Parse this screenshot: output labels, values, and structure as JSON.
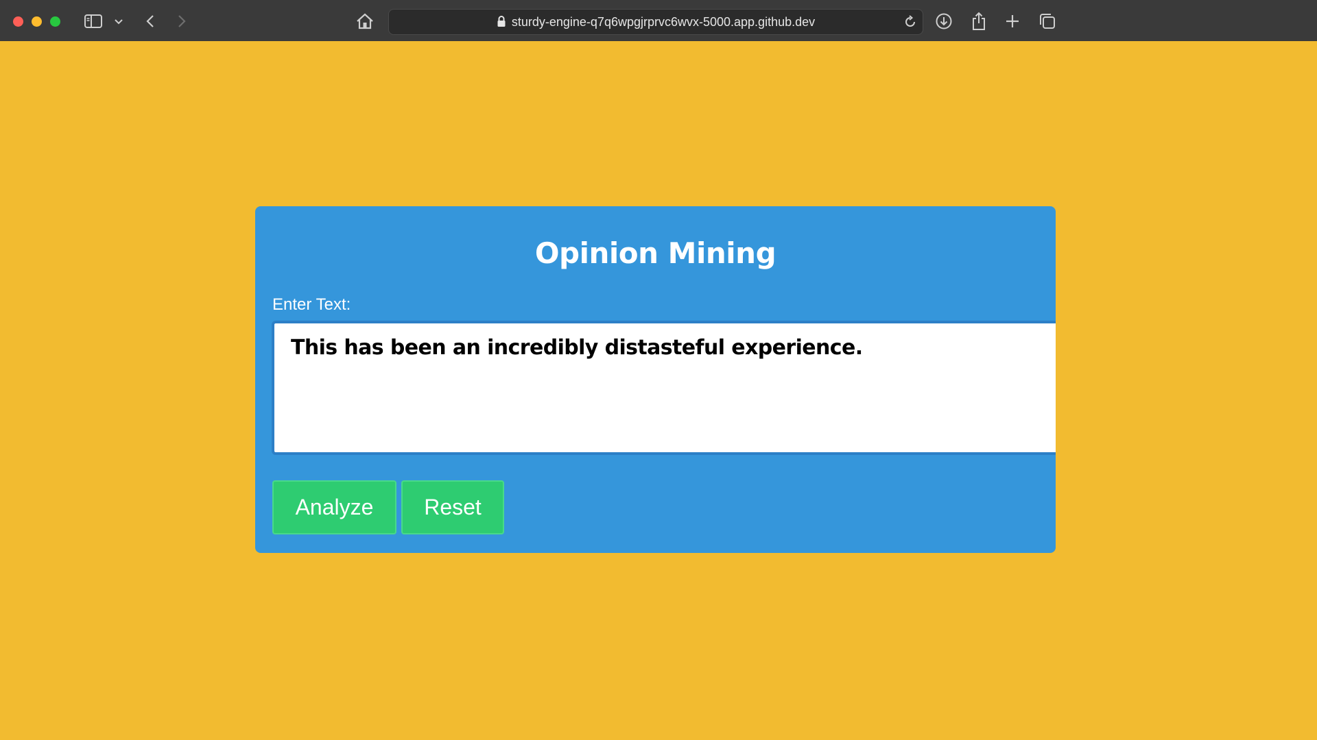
{
  "browser": {
    "url": "sturdy-engine-q7q6wpgjrprvc6wvx-5000.app.github.dev",
    "icons": {
      "sidebar": "sidebar-icon",
      "sidebar_menu": "chevron-down-icon",
      "back": "chevron-left-icon",
      "forward": "chevron-right-icon",
      "home": "home-icon",
      "lock": "lock-icon",
      "reload": "reload-icon",
      "downloads": "download-icon",
      "share": "share-icon",
      "new_tab": "plus-icon",
      "tab_overview": "tabs-icon"
    }
  },
  "page": {
    "background_color": "#f2bb30",
    "card_color": "#3596db",
    "title": "Opinion Mining",
    "input_label": "Enter Text:",
    "input_value": "This has been an incredibly distasteful experience.",
    "buttons": {
      "analyze": "Analyze",
      "reset": "Reset"
    },
    "button_color": "#2ecc71"
  }
}
